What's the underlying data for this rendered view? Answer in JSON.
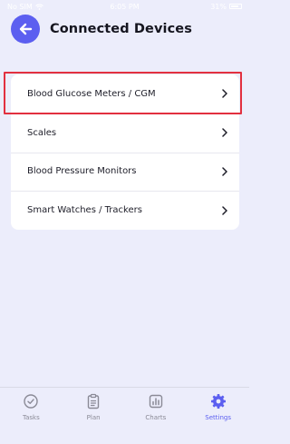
{
  "status_bar": {
    "carrier": "No SIM",
    "time": "6:05 PM",
    "battery": "31%"
  },
  "header": {
    "title": "Connected Devices"
  },
  "devices": [
    {
      "label": "Blood Glucose Meters / CGM"
    },
    {
      "label": "Scales"
    },
    {
      "label": "Blood Pressure Monitors"
    },
    {
      "label": "Smart Watches / Trackers"
    }
  ],
  "tabs": [
    {
      "label": "Tasks",
      "icon": "check-circle-icon"
    },
    {
      "label": "Plan",
      "icon": "clipboard-icon"
    },
    {
      "label": "Charts",
      "icon": "bar-chart-icon"
    },
    {
      "label": "Settings",
      "icon": "gear-icon"
    }
  ],
  "colors": {
    "accent": "#5c5ff0",
    "background": "#ecedfb",
    "highlight": "#e2303f"
  }
}
